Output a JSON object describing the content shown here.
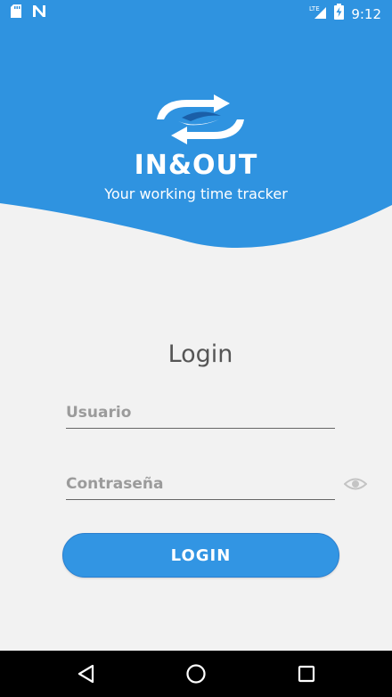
{
  "status_bar": {
    "time": "9:12",
    "network_label": "LTE",
    "icons": [
      "sd-card-icon",
      "notification-n-icon",
      "lte-signal-icon",
      "battery-charging-icon"
    ]
  },
  "header": {
    "brand": "IN&OUT",
    "tagline": "Your working time tracker",
    "accent_color": "#2f93e0"
  },
  "login": {
    "title": "Login",
    "username_placeholder": "Usuario",
    "username_value": "",
    "password_placeholder": "Contraseña",
    "password_value": "",
    "button_label": "LOGIN",
    "button_color": "#3295e3"
  },
  "nav_bar": {
    "icons": [
      "back-triangle-icon",
      "home-circle-icon",
      "recents-square-icon"
    ]
  }
}
